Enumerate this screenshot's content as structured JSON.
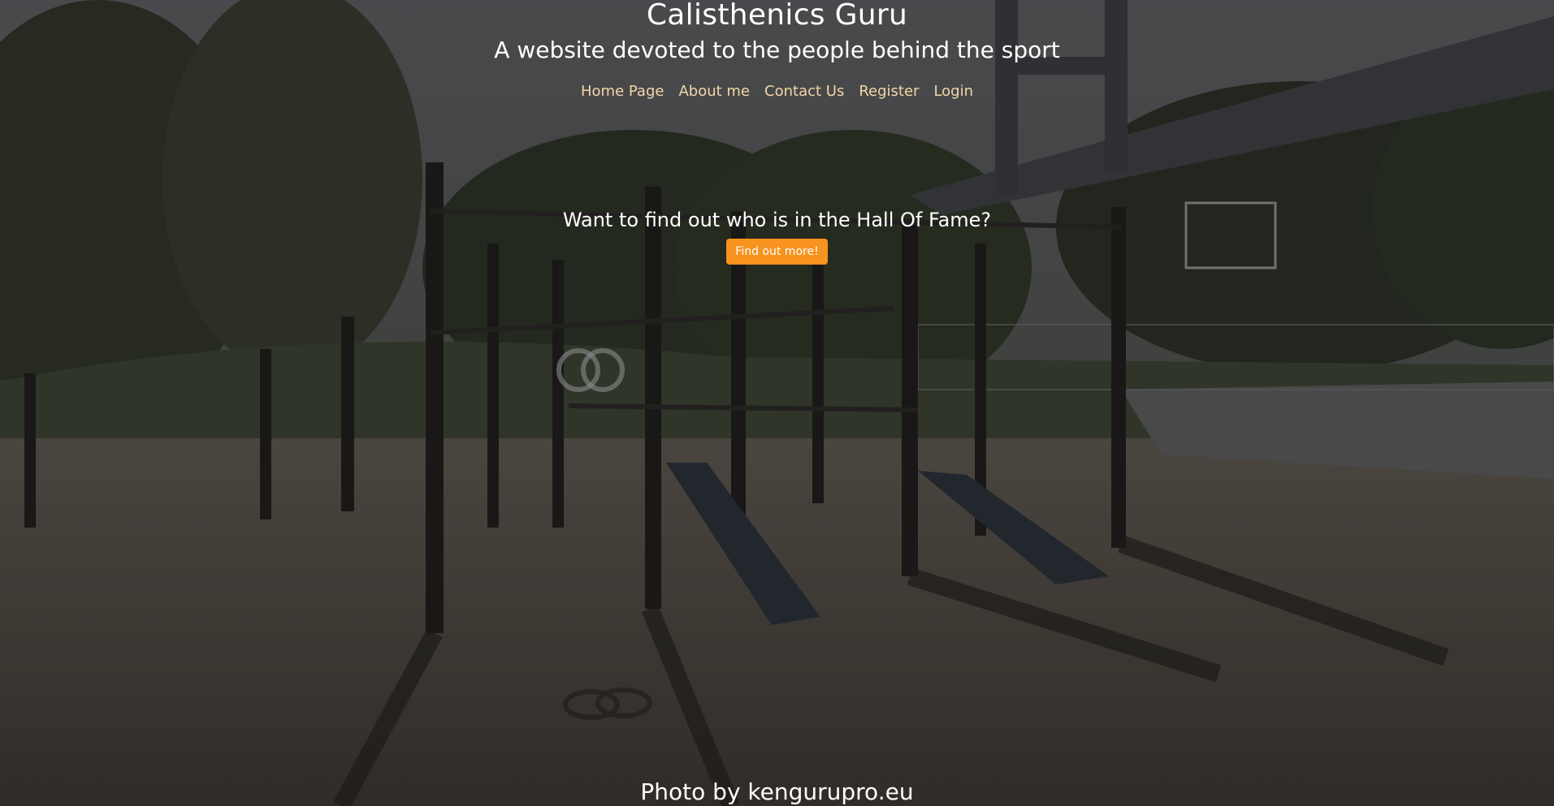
{
  "header": {
    "title": "Calisthenics Guru",
    "subtitle": "A website devoted to the people behind the sport"
  },
  "nav": {
    "items": [
      {
        "label": "Home Page"
      },
      {
        "label": "About me"
      },
      {
        "label": "Contact Us"
      },
      {
        "label": "Register"
      },
      {
        "label": "Login"
      }
    ]
  },
  "hall_of_fame": {
    "heading": "Want to find out who is in the Hall Of Fame?",
    "button_label": "Find out more!"
  },
  "footer": {
    "credit": "Photo by kengurupro.eu"
  },
  "colors": {
    "nav_link": "#f3d6a8",
    "button_bg": "#f7931e",
    "text": "#ffffff"
  }
}
